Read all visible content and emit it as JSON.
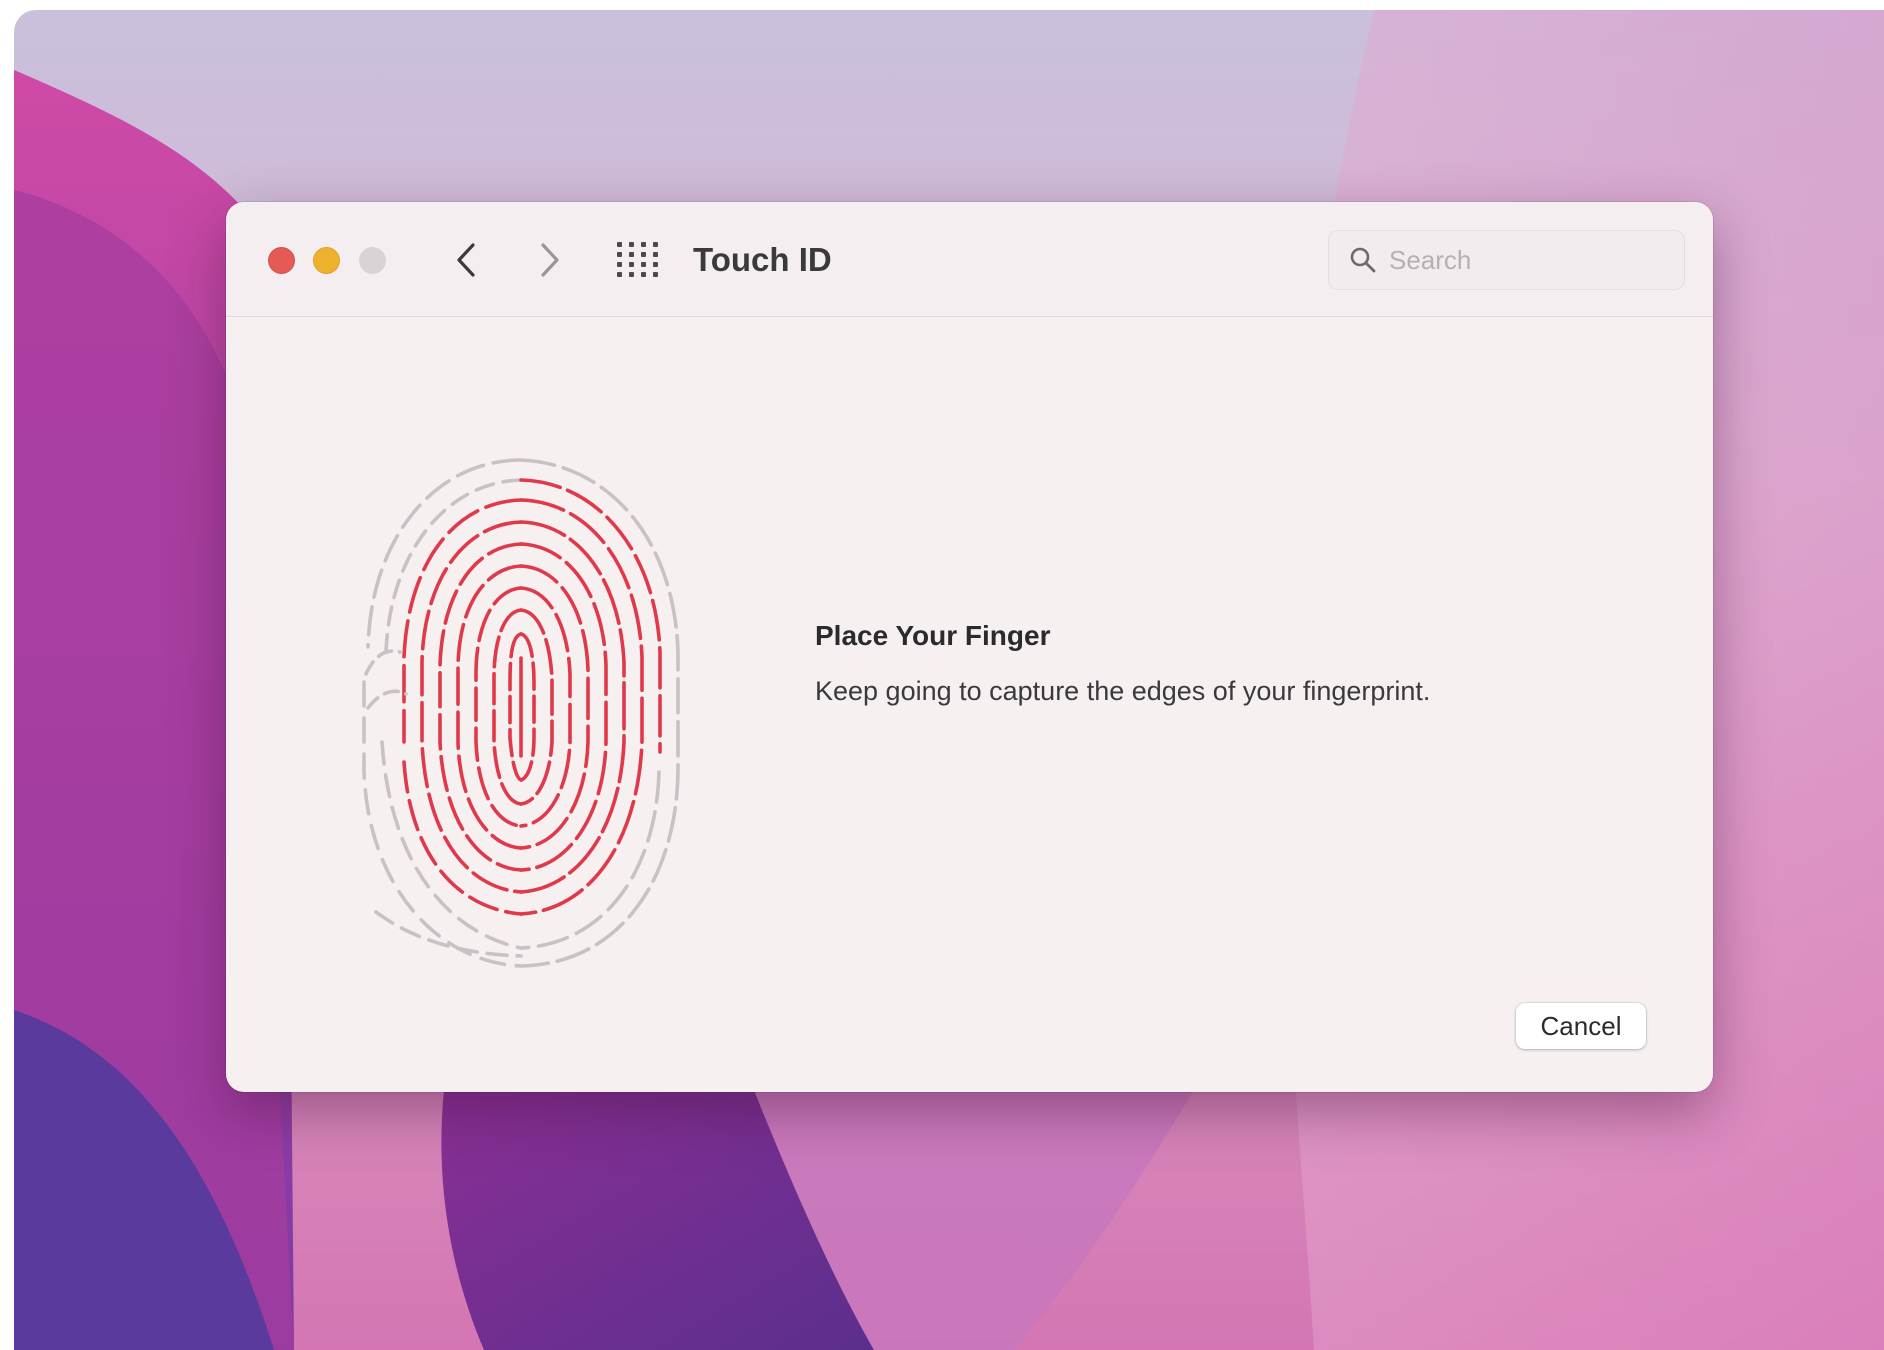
{
  "window": {
    "title": "Touch ID"
  },
  "search": {
    "placeholder": "Search",
    "value": ""
  },
  "content": {
    "heading": "Place Your Finger",
    "message": "Keep going to capture the edges of your fingerprint."
  },
  "buttons": {
    "cancel_label": "Cancel"
  },
  "icons": {
    "back": "chevron-left-icon",
    "forward": "chevron-right-icon",
    "grid": "grid-icon",
    "search": "search-icon",
    "fingerprint": "fingerprint-icon"
  },
  "colors": {
    "close": "#e45a54",
    "minimize": "#efb12d",
    "zoom_disabled": "#d9d3d5",
    "fingerprint_captured": "#e0394a",
    "fingerprint_pending": "#c7c2c4"
  }
}
